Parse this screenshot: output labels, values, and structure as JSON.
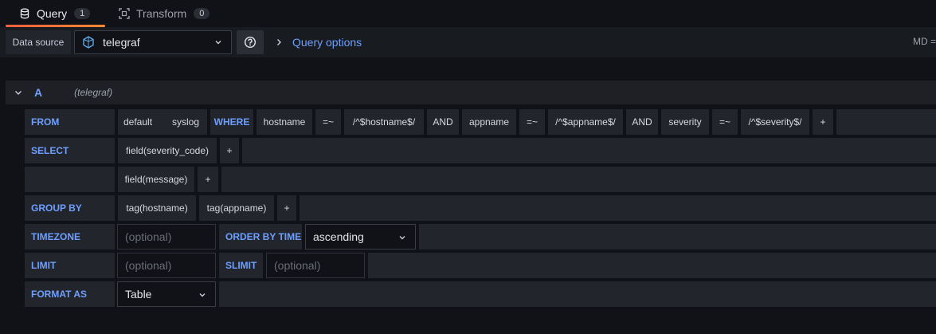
{
  "tabs": [
    {
      "label": "Query",
      "count": "1",
      "icon": "database-icon"
    },
    {
      "label": "Transform",
      "count": "0",
      "icon": "transform-icon"
    }
  ],
  "toolbar": {
    "datasource_label": "Data source",
    "datasource_name": "telegraf",
    "query_options_label": "Query options",
    "md_info": "MD ="
  },
  "query": {
    "ref_id": "A",
    "datasource": "(telegraf)",
    "from": {
      "label": "FROM",
      "policy": "default",
      "measurement": "syslog",
      "where_label": "WHERE",
      "conditions": [
        "hostname",
        "=~",
        "/^$hostname$/",
        "AND",
        "appname",
        "=~",
        "/^$appname$/",
        "AND",
        "severity",
        "=~",
        "/^$severity$/"
      ],
      "add": "+"
    },
    "select": {
      "label": "SELECT",
      "fields": [
        "field(severity_code)",
        "field(message)"
      ],
      "add": "+"
    },
    "group_by": {
      "label": "GROUP BY",
      "tags": [
        "tag(hostname)",
        "tag(appname)"
      ],
      "add": "+"
    },
    "timezone": {
      "label": "TIMEZONE",
      "placeholder": "(optional)"
    },
    "order_by_time": {
      "label": "ORDER BY TIME",
      "value": "ascending"
    },
    "limit": {
      "label": "LIMIT",
      "placeholder": "(optional)"
    },
    "slimit": {
      "label": "SLIMIT",
      "placeholder": "(optional)"
    },
    "format_as": {
      "label": "FORMAT AS",
      "value": "Table"
    }
  },
  "colors": {
    "accent": "#6e9fff",
    "active_tab": "#f55f3e",
    "background": "#111217"
  }
}
